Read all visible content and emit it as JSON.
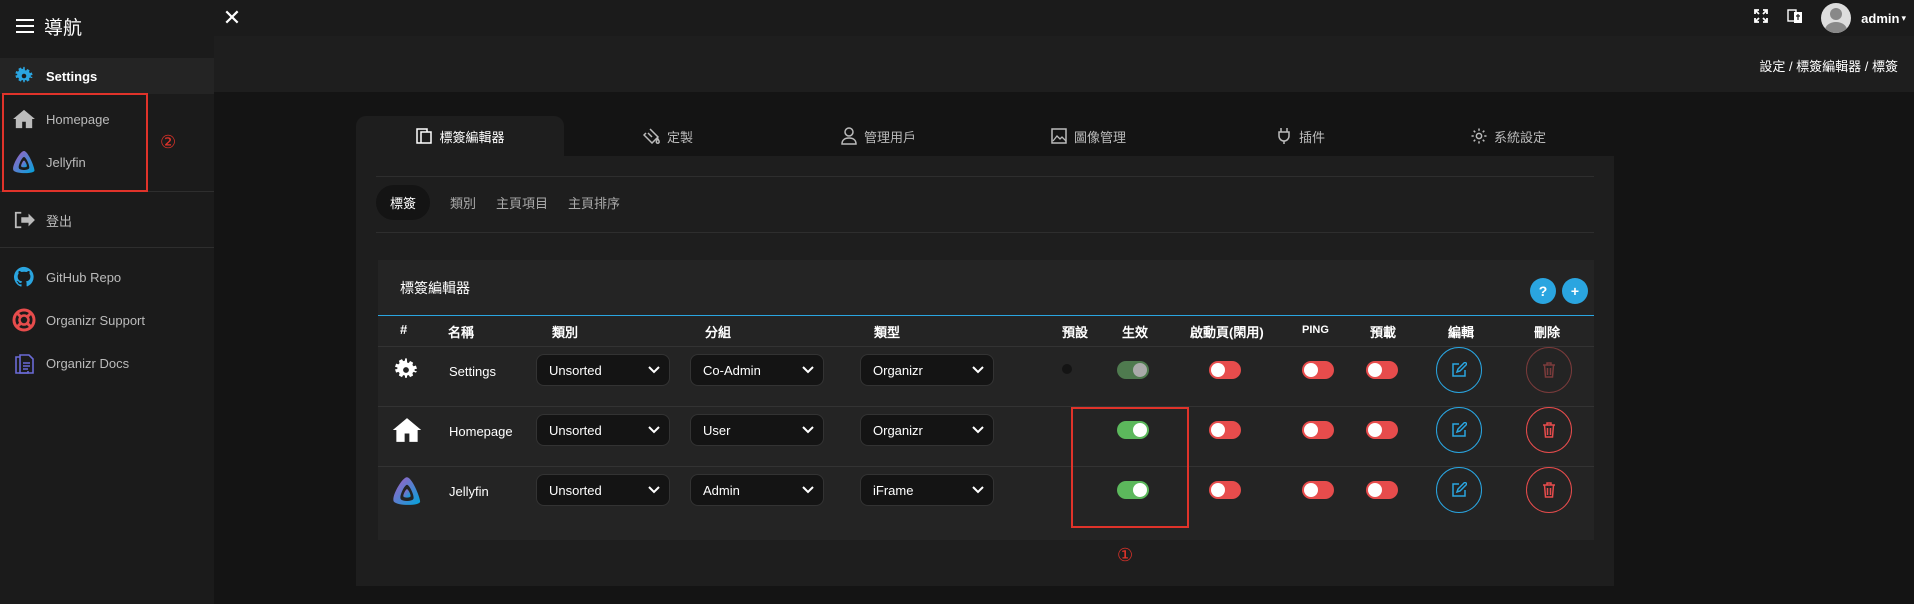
{
  "nav": {
    "title": "導航",
    "items": [
      {
        "label": "Settings",
        "icon": "gear-icon"
      },
      {
        "label": "Homepage",
        "icon": "house-icon"
      },
      {
        "label": "Jellyfin",
        "icon": "jellyfin-icon"
      },
      {
        "label": "登出",
        "icon": "logout-icon"
      },
      {
        "label": "GitHub Repo",
        "icon": "github-icon"
      },
      {
        "label": "Organizr Support",
        "icon": "lifebuoy-icon"
      },
      {
        "label": "Organizr Docs",
        "icon": "document-icon"
      }
    ]
  },
  "topbar": {
    "user": "admin"
  },
  "breadcrumb": "設定 / 標簽編輯器 / 標簽",
  "main_tabs": [
    {
      "label": "標簽編輯器",
      "icon": "tab-editor-icon"
    },
    {
      "label": "定製",
      "icon": "paint-bucket-icon"
    },
    {
      "label": "管理用戶",
      "icon": "user-icon"
    },
    {
      "label": "圖像管理",
      "icon": "image-icon"
    },
    {
      "label": "插件",
      "icon": "plug-icon"
    },
    {
      "label": "系統設定",
      "icon": "gear-icon"
    }
  ],
  "sub_tabs": [
    "標簽",
    "類別",
    "主頁項目",
    "主頁排序"
  ],
  "card": {
    "title": "標簽編輯器",
    "help_label": "?",
    "add_label": "+"
  },
  "table": {
    "headers": [
      "#",
      "名稱",
      "類別",
      "分組",
      "類型",
      "預設",
      "生效",
      "啟動頁(閑用)",
      "PING",
      "預載",
      "編輯",
      "刪除"
    ],
    "rows": [
      {
        "name": "Settings",
        "icon": "gear-icon",
        "category": "Unsorted",
        "group": "Co-Admin",
        "type": "Organizr",
        "default": false,
        "active": true,
        "active_locked": true,
        "splash": false,
        "ping": false,
        "preload": false
      },
      {
        "name": "Homepage",
        "icon": "house-icon",
        "category": "Unsorted",
        "group": "User",
        "type": "Organizr",
        "default": false,
        "active": true,
        "active_locked": false,
        "splash": false,
        "ping": false,
        "preload": false
      },
      {
        "name": "Jellyfin",
        "icon": "jellyfin-icon",
        "category": "Unsorted",
        "group": "Admin",
        "type": "iFrame",
        "default": false,
        "active": true,
        "active_locked": false,
        "splash": false,
        "ping": false,
        "preload": false
      }
    ]
  },
  "annotations": {
    "one": "①",
    "two": "②"
  },
  "colors": {
    "accent": "#2aa5e0",
    "danger": "#e74c4c",
    "success": "#5cb85c",
    "annotation": "#e0332a"
  }
}
